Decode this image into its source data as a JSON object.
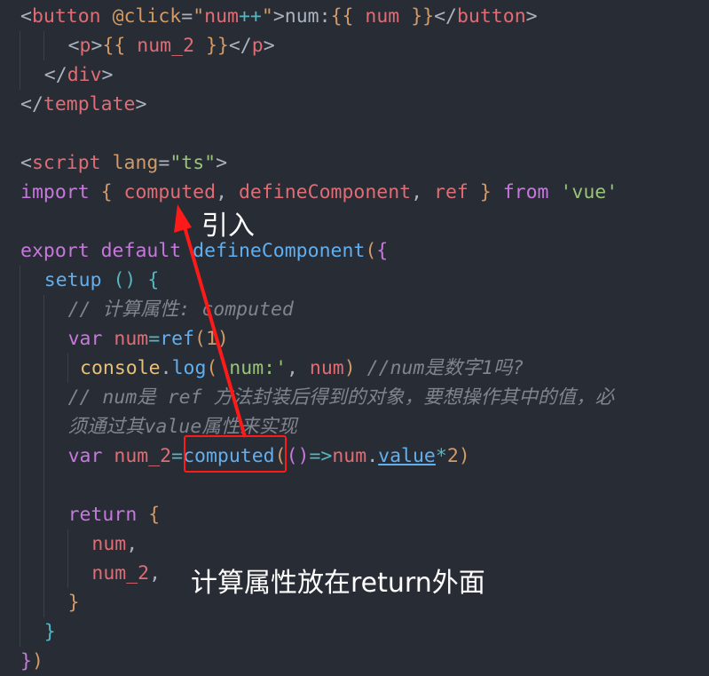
{
  "editor": {
    "background": "#282c34",
    "lines": [
      {
        "indent": 0,
        "guides": [],
        "tokens": [
          [
            "<",
            "p"
          ],
          [
            "button",
            "t"
          ],
          [
            " @click",
            "a"
          ],
          [
            "=",
            "p"
          ],
          [
            "\"",
            "a"
          ],
          [
            "num",
            "t"
          ],
          [
            "++",
            "cy"
          ],
          [
            "\"",
            "a"
          ],
          [
            ">",
            "p"
          ],
          [
            "num:",
            "p"
          ],
          [
            "{{",
            "a"
          ],
          [
            " num ",
            "t"
          ],
          [
            "}}",
            "a"
          ],
          [
            "</",
            "p"
          ],
          [
            "button",
            "t"
          ],
          [
            ">",
            "p"
          ]
        ]
      },
      {
        "indent": 4,
        "guides": [
          0,
          2
        ],
        "tokens": [
          [
            "<",
            "p"
          ],
          [
            "p",
            "t"
          ],
          [
            ">",
            "p"
          ],
          [
            "{{",
            "a"
          ],
          [
            " num_2 ",
            "t"
          ],
          [
            "}}",
            "a"
          ],
          [
            "</",
            "p"
          ],
          [
            "p",
            "t"
          ],
          [
            ">",
            "p"
          ]
        ]
      },
      {
        "indent": 2,
        "guides": [
          0
        ],
        "tokens": [
          [
            "</",
            "p"
          ],
          [
            "div",
            "t"
          ],
          [
            ">",
            "p"
          ]
        ]
      },
      {
        "indent": 0,
        "guides": [],
        "tokens": [
          [
            "</",
            "p"
          ],
          [
            "template",
            "t"
          ],
          [
            ">",
            "p"
          ]
        ]
      },
      {
        "indent": 0,
        "guides": [],
        "tokens": []
      },
      {
        "indent": 0,
        "guides": [],
        "tokens": [
          [
            "<",
            "p"
          ],
          [
            "script",
            "t"
          ],
          [
            " lang",
            "a"
          ],
          [
            "=",
            "p"
          ],
          [
            "\"ts\"",
            "s"
          ],
          [
            ">",
            "p"
          ]
        ]
      },
      {
        "indent": 0,
        "guides": [],
        "tokens": [
          [
            "import",
            "k"
          ],
          [
            " {",
            "a"
          ],
          [
            " computed",
            "t"
          ],
          [
            ",",
            "p"
          ],
          [
            " defineComponent",
            "t"
          ],
          [
            ",",
            "p"
          ],
          [
            " ref",
            "t"
          ],
          [
            " }",
            "a"
          ],
          [
            " from",
            "k"
          ],
          [
            " 'vue'",
            "s"
          ]
        ]
      },
      {
        "indent": 0,
        "guides": [],
        "tokens": []
      },
      {
        "indent": 0,
        "guides": [],
        "tokens": [
          [
            "export",
            "k"
          ],
          [
            " default",
            "k"
          ],
          [
            " defineComponent",
            "f"
          ],
          [
            "(",
            "a"
          ],
          [
            "{",
            "k"
          ]
        ]
      },
      {
        "indent": 2,
        "guides": [
          0
        ],
        "tokens": [
          [
            "setup",
            "f"
          ],
          [
            " ()",
            "cy"
          ],
          [
            " {",
            "cy"
          ]
        ]
      },
      {
        "indent": 4,
        "guides": [
          0,
          2
        ],
        "tokens": [
          [
            "// 计算属性: computed",
            "c"
          ]
        ]
      },
      {
        "indent": 4,
        "guides": [
          0,
          2
        ],
        "tokens": [
          [
            "var",
            "k"
          ],
          [
            " num",
            "t"
          ],
          [
            "=",
            "cy"
          ],
          [
            "ref",
            "f"
          ],
          [
            "(",
            "a"
          ],
          [
            "1",
            "a"
          ],
          [
            ")",
            "a"
          ]
        ]
      },
      {
        "indent": 5,
        "guides": [
          0,
          2,
          4
        ],
        "tokens": [
          [
            "console",
            "y"
          ],
          [
            ".",
            "p"
          ],
          [
            "log",
            "f"
          ],
          [
            "(",
            "a"
          ],
          [
            "'num:'",
            "s"
          ],
          [
            ", ",
            "p"
          ],
          [
            "num",
            "t"
          ],
          [
            ")",
            "a"
          ],
          [
            " //num是数字1吗?",
            "c"
          ]
        ]
      },
      {
        "indent": 4,
        "guides": [
          0,
          2
        ],
        "tokens": [
          [
            "// num是 ref 方法封装后得到的对象，要想操作其中的值，必",
            "c"
          ]
        ]
      },
      {
        "indent": 4,
        "guides": [
          0,
          2
        ],
        "tokens": [
          [
            "须通过其value属性来实现",
            "c"
          ]
        ]
      },
      {
        "indent": 4,
        "guides": [
          0,
          2
        ],
        "tokens": [
          [
            "var",
            "k"
          ],
          [
            " num_2",
            "t"
          ],
          [
            "=",
            "cy"
          ],
          [
            "computed",
            "f"
          ],
          [
            "(",
            "a"
          ],
          [
            "()",
            "k"
          ],
          [
            "=>",
            "cy"
          ],
          [
            "num",
            "t"
          ],
          [
            ".",
            "p"
          ],
          [
            "value",
            "u"
          ],
          [
            "*",
            "cy"
          ],
          [
            "2",
            "a"
          ],
          [
            ")",
            "a"
          ]
        ]
      },
      {
        "indent": 0,
        "guides": [
          0,
          2
        ],
        "tokens": []
      },
      {
        "indent": 4,
        "guides": [
          0,
          2
        ],
        "tokens": [
          [
            "return",
            "k"
          ],
          [
            " {",
            "a"
          ]
        ]
      },
      {
        "indent": 6,
        "guides": [
          0,
          2,
          4
        ],
        "tokens": [
          [
            "num",
            "t"
          ],
          [
            ",",
            "p"
          ]
        ]
      },
      {
        "indent": 6,
        "guides": [
          0,
          2,
          4
        ],
        "tokens": [
          [
            "num_2",
            "t"
          ],
          [
            ",",
            "p"
          ]
        ]
      },
      {
        "indent": 4,
        "guides": [
          0,
          2
        ],
        "tokens": [
          [
            "}",
            "a"
          ]
        ]
      },
      {
        "indent": 2,
        "guides": [
          0
        ],
        "tokens": [
          [
            "}",
            "cy"
          ]
        ]
      },
      {
        "indent": 0,
        "guides": [],
        "tokens": [
          [
            "}",
            "k"
          ],
          [
            ")",
            "a"
          ]
        ]
      }
    ]
  },
  "annotations": {
    "import_note": "引入",
    "return_note": "计算属性放在return外面",
    "highlight_color": "#ff1a1a"
  }
}
